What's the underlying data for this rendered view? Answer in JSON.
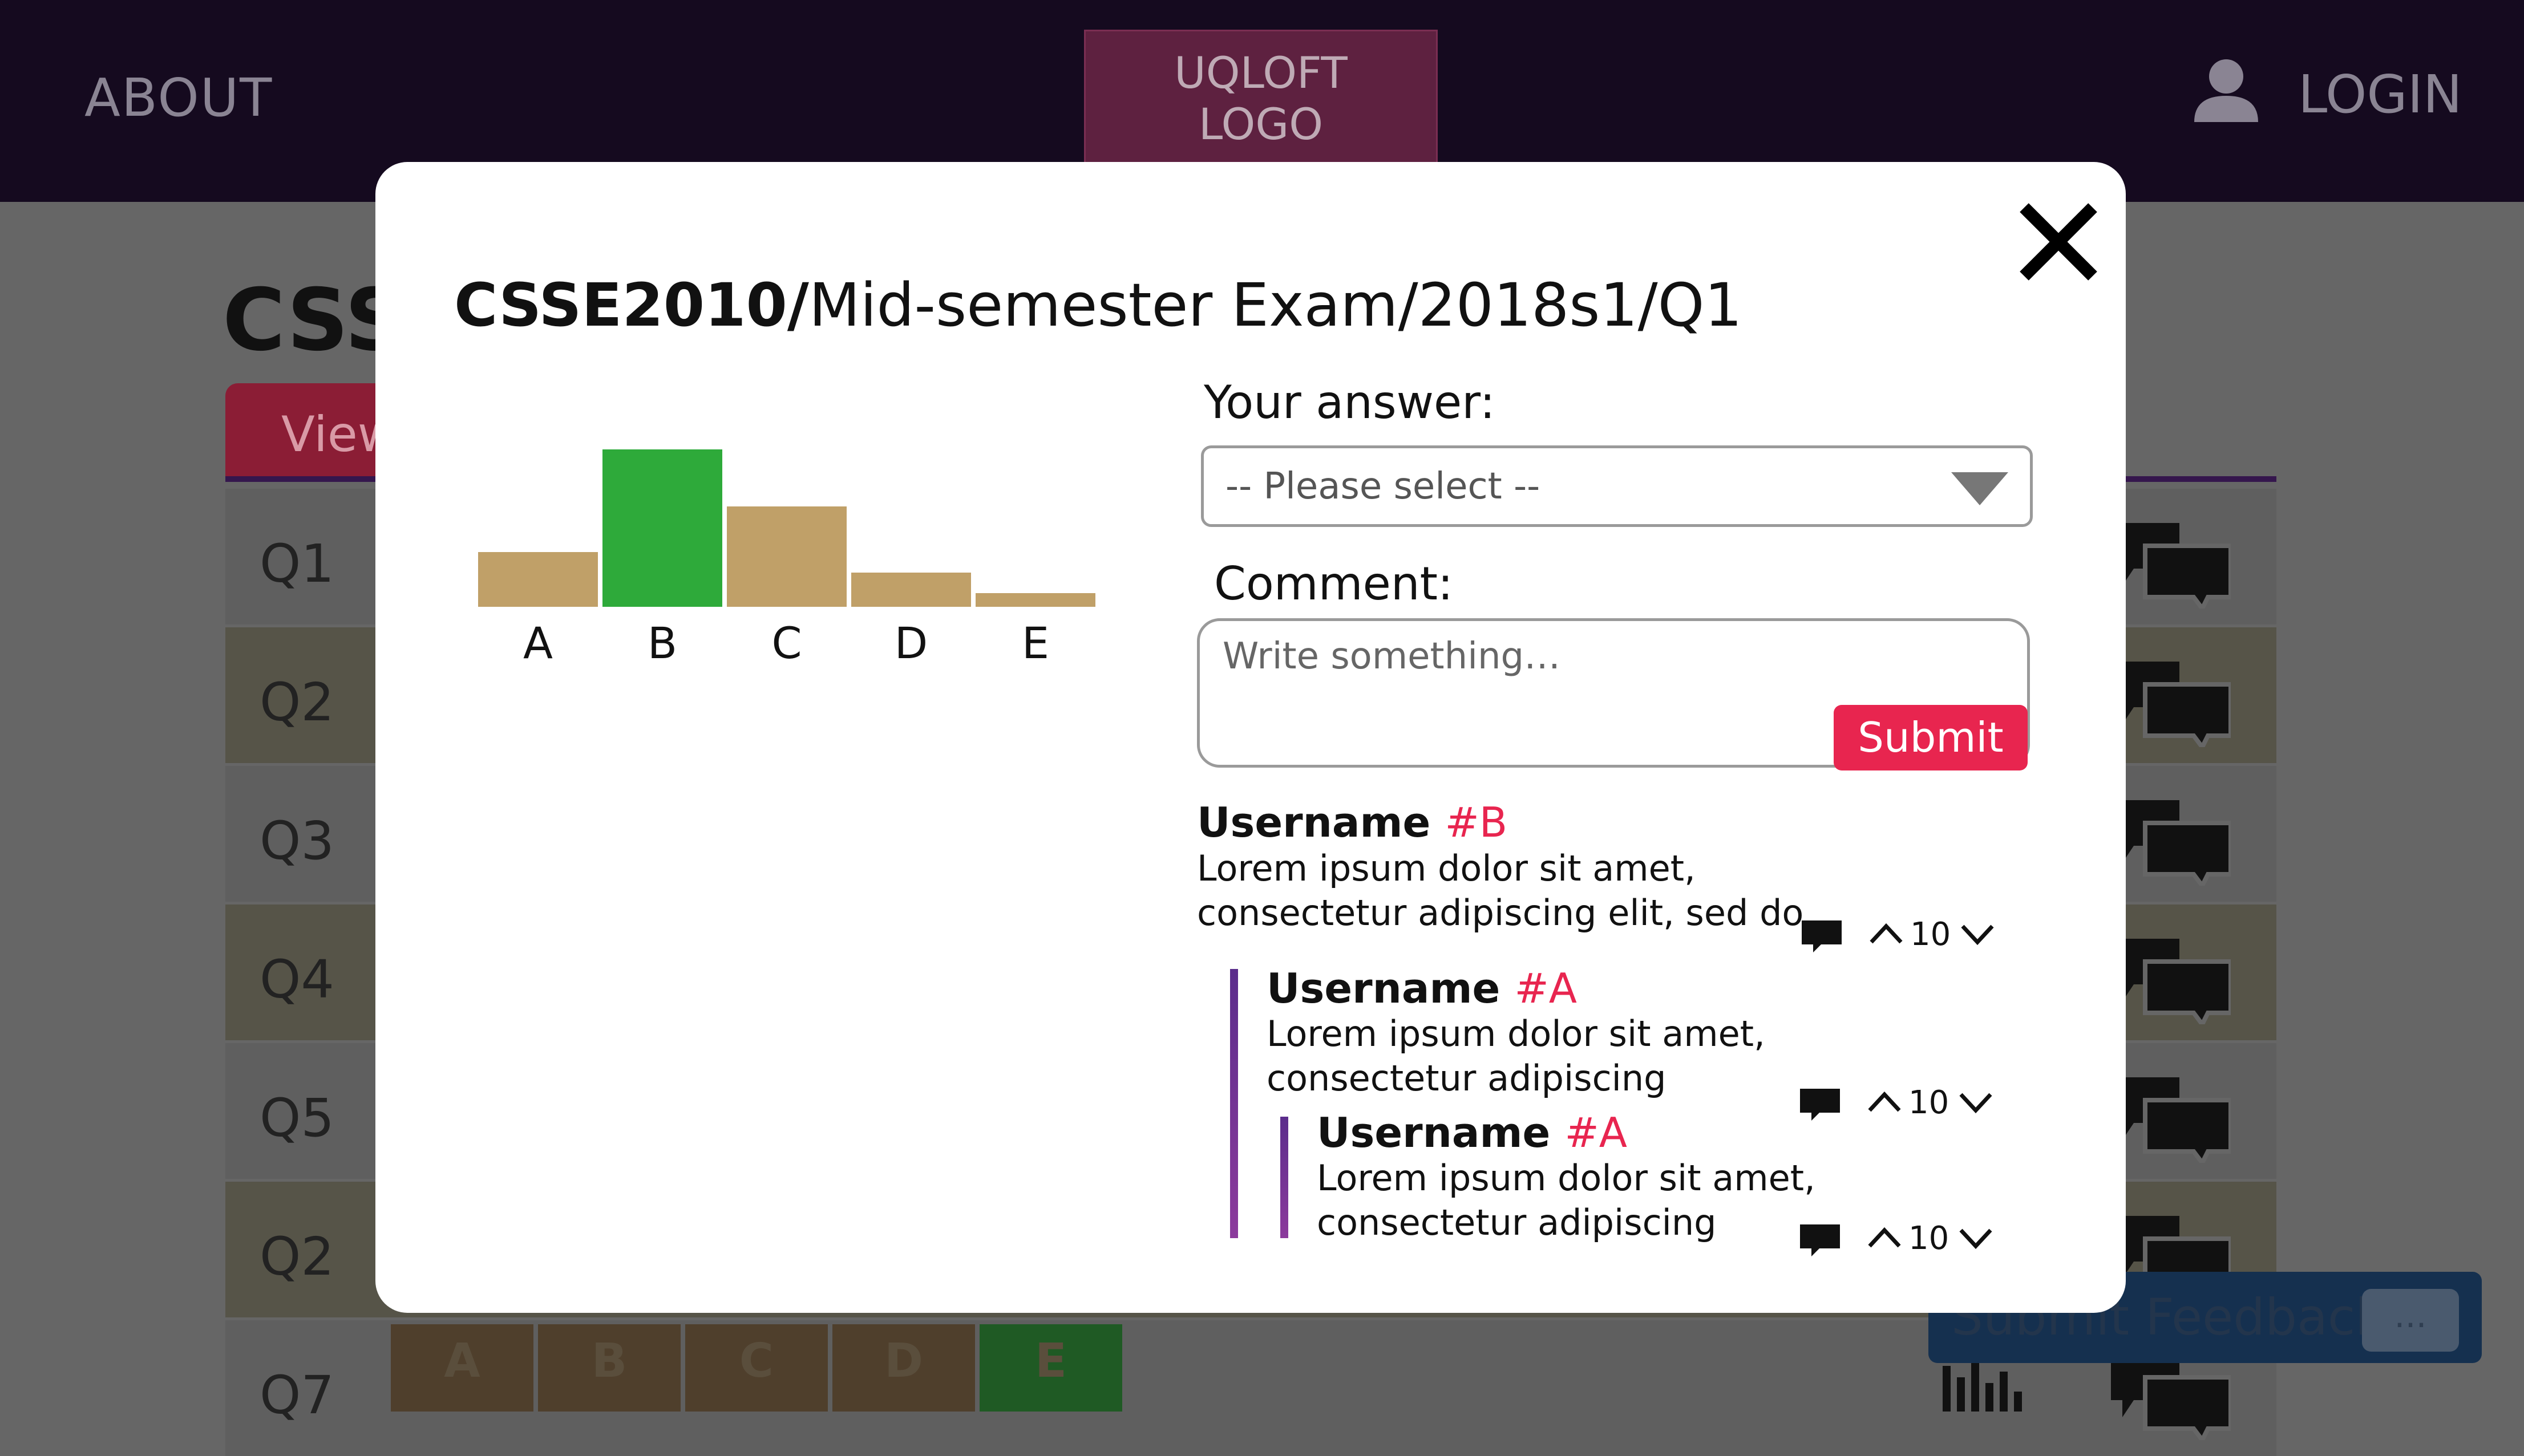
{
  "header": {
    "about": "ABOUT",
    "logo": "UQLOFT\nLOGO",
    "login": "LOGIN"
  },
  "page": {
    "title": "CSSE",
    "view_tab": "View",
    "questions": [
      "Q1",
      "Q2",
      "Q3",
      "Q4",
      "Q5",
      "Q2",
      "Q7"
    ],
    "row7_options": [
      "A",
      "B",
      "C",
      "D",
      "E"
    ],
    "feedback": "Submit Feedback",
    "feedback_chat": "..."
  },
  "modal": {
    "title_bold": "CSSE2010/",
    "title_rest": "Mid-semester Exam/2018s1/Q1",
    "answer_label": "Your answer:",
    "select_placeholder": "-- Please select --",
    "comment_label": "Comment:",
    "comment_placeholder": "Write something…",
    "submit": "Submit",
    "comments": [
      {
        "user": "Username",
        "tag": "#B",
        "text": "Lorem ipsum dolor sit amet, consectetur adipiscing elit, sed do",
        "votes": "10"
      },
      {
        "user": "Username",
        "tag": "#A",
        "text": "Lorem ipsum dolor sit amet, consectetur adipiscing",
        "votes": "10"
      },
      {
        "user": "Username",
        "tag": "#A",
        "text": "Lorem ipsum dolor sit amet, consectetur adipiscing",
        "votes": "10"
      }
    ]
  },
  "colors": {
    "correct": "#2eaa3a",
    "other": "#c0a068",
    "accent": "#e8254f",
    "thread": "#6a2f90"
  },
  "chart_data": {
    "type": "bar",
    "categories": [
      "A",
      "B",
      "C",
      "D",
      "E"
    ],
    "values": [
      24,
      69,
      44,
      15,
      6
    ],
    "ylim": [
      0,
      75
    ],
    "highlight": "B",
    "title": "",
    "xlabel": "",
    "ylabel": "",
    "grid": false
  }
}
